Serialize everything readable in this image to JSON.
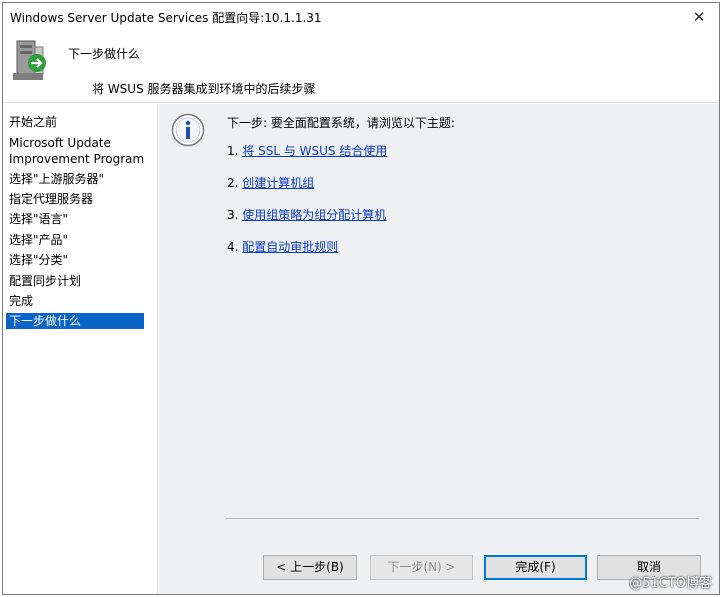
{
  "window": {
    "title": "Windows Server Update Services 配置向导:10.1.1.31",
    "close_glyph": "✕"
  },
  "header": {
    "title": "下一步做什么",
    "subtitle": "将 WSUS 服务器集成到环境中的后续步骤"
  },
  "sidebar": {
    "items": [
      {
        "label": "开始之前"
      },
      {
        "label": "Microsoft Update"
      },
      {
        "label": "Improvement Program"
      },
      {
        "label": "选择\"上游服务器\""
      },
      {
        "label": "指定代理服务器"
      },
      {
        "label": "选择\"语言\""
      },
      {
        "label": "选择\"产品\""
      },
      {
        "label": "选择\"分类\""
      },
      {
        "label": "配置同步计划"
      },
      {
        "label": "完成"
      },
      {
        "label": "下一步做什么",
        "active": true
      }
    ]
  },
  "main": {
    "intro": "下一步: 要全面配置系统，请浏览以下主题:",
    "steps": [
      {
        "number": "1.",
        "link": "将 SSL 与 WSUS 结合使用"
      },
      {
        "number": "2.",
        "link": "创建计算机组"
      },
      {
        "number": "3.",
        "link": "使用组策略为组分配计算机"
      },
      {
        "number": "4.",
        "link": "配置自动审批规则"
      }
    ]
  },
  "buttons": {
    "back": "< 上一步(B)",
    "next": "下一步(N) >",
    "finish": "完成(F)",
    "cancel": "取消"
  },
  "watermark": "@51CTO博客",
  "colors": {
    "accent": "#0a64c8",
    "link": "#0b39c8",
    "content_bg": "#eef0f2"
  }
}
